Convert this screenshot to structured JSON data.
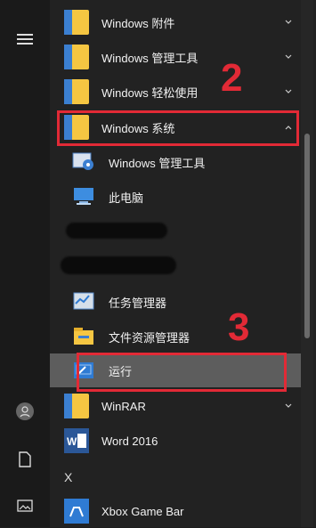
{
  "rail": {
    "menu_icon": "hamburger-menu-icon",
    "user_icon": "user-icon",
    "document_icon": "document-icon",
    "pictures_icon": "pictures-icon"
  },
  "menu": {
    "rows": [
      {
        "label": "Windows 附件",
        "type": "folder",
        "chevron": "down"
      },
      {
        "label": "Windows 管理工具",
        "type": "folder",
        "chevron": "down"
      },
      {
        "label": "Windows 轻松使用",
        "type": "folder",
        "chevron": "down"
      },
      {
        "label": "Windows 系统",
        "type": "folder",
        "chevron": "up"
      },
      {
        "label": "Windows 管理工具",
        "type": "app"
      },
      {
        "label": "此电脑",
        "type": "app"
      },
      {
        "label": "任务管理器",
        "type": "app"
      },
      {
        "label": "文件资源管理器",
        "type": "app"
      },
      {
        "label": "运行",
        "type": "app"
      },
      {
        "label": "WinRAR",
        "type": "folder",
        "chevron": "down"
      },
      {
        "label": "Word 2016",
        "type": "app"
      },
      {
        "label": "X",
        "type": "header"
      },
      {
        "label": "Xbox Game Bar",
        "type": "app"
      }
    ]
  },
  "annotations": {
    "step2": "2",
    "step3": "3",
    "highlight_color": "#e22a36"
  },
  "colors": {
    "folder_yellow": "#f5c642",
    "folder_blue": "#3b7fd1",
    "background": "#222222"
  }
}
